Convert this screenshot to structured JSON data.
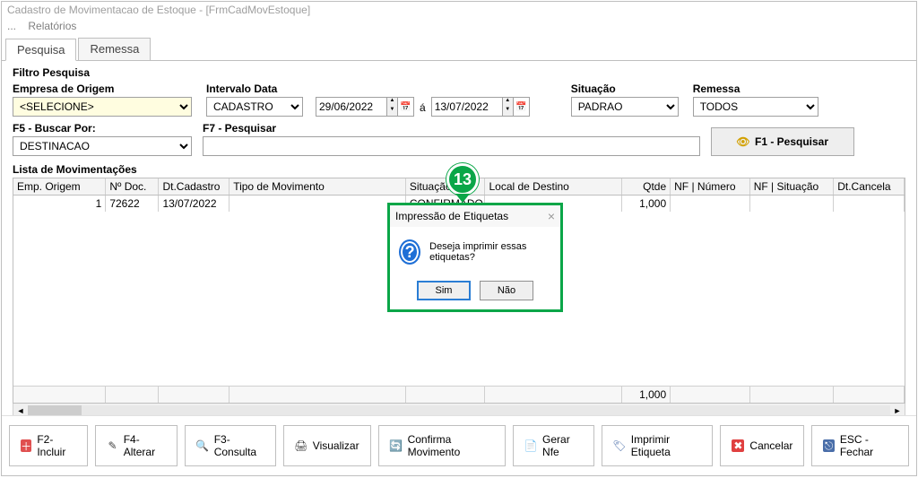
{
  "window": {
    "title": "Cadastro de Movimentacao de Estoque - [FrmCadMovEstoque]"
  },
  "menubar": {
    "item1": "...",
    "item2": "Relatórios"
  },
  "tabs": {
    "pesquisa": "Pesquisa",
    "remessa": "Remessa"
  },
  "filter": {
    "section_label": "Filtro Pesquisa",
    "empresa_label": "Empresa de Origem",
    "empresa_value": "<SELECIONE>",
    "intervalo_label": "Intervalo Data",
    "intervalo_value": "CADASTRO",
    "date_from": "29/06/2022",
    "date_sep": "á",
    "date_to": "13/07/2022",
    "situacao_label": "Situação",
    "situacao_value": "PADRAO",
    "remessa_label": "Remessa",
    "remessa_value": "TODOS",
    "buscar_label": "F5 - Buscar Por:",
    "buscar_value": "DESTINACAO",
    "f7_label": "F7 - Pesquisar",
    "btn_pesquisar": "F1 - Pesquisar"
  },
  "grid": {
    "list_label": "Lista de Movimentações",
    "headers": {
      "emp": "Emp. Origem",
      "doc": "Nº Doc.",
      "cad": "Dt.Cadastro",
      "tipo": "Tipo de Movimento",
      "sit": "Situação",
      "dest": "Local de Destino",
      "qtd": "Qtde",
      "nfn": "NF | Número",
      "nfs": "NF | Situação",
      "canc": "Dt.Cancela"
    },
    "rows": [
      {
        "emp": "1",
        "doc": "72622",
        "cad": "13/07/2022",
        "tipo": "",
        "sit": "CONFIRMADO",
        "dest": "",
        "qtd": "1,000",
        "nfn": "",
        "nfs": "",
        "canc": ""
      }
    ],
    "footer_qtd": "1,000"
  },
  "dialog": {
    "title": "Impressão de Etiquetas",
    "message": "Deseja imprimir essas etiquetas?",
    "yes": "Sim",
    "no": "Não"
  },
  "actions": {
    "incluir": "F2-Incluir",
    "alterar": "F4-Alterar",
    "consulta": "F3-Consulta",
    "visualizar": "Visualizar",
    "confirma": "Confirma Movimento",
    "gerar_nfe": "Gerar Nfe",
    "imprimir": "Imprimir Etiqueta",
    "cancelar": "Cancelar",
    "fechar": "ESC - Fechar"
  },
  "step": {
    "number": "13"
  }
}
